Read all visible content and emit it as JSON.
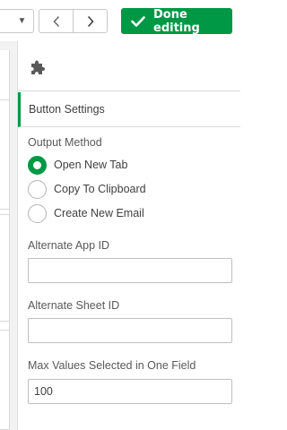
{
  "toolbar": {
    "done_label": "Done editing",
    "accent": "#009845",
    "icons": {
      "dropdown": "caret-down-icon",
      "prev": "chevron-left-icon",
      "next": "chevron-right-icon",
      "done": "checkmark-icon"
    }
  },
  "panel": {
    "header_icon": "puzzle-piece-icon",
    "section_title": "Button Settings",
    "output_method": {
      "label": "Output Method",
      "options": [
        "Open New Tab",
        "Copy To Clipboard",
        "Create New Email"
      ],
      "selected": "Open New Tab"
    },
    "alternate_app_id": {
      "label": "Alternate App ID",
      "value": ""
    },
    "alternate_sheet_id": {
      "label": "Alternate Sheet ID",
      "value": ""
    },
    "max_values": {
      "label": "Max Values Selected in One Field",
      "value": "100"
    }
  }
}
